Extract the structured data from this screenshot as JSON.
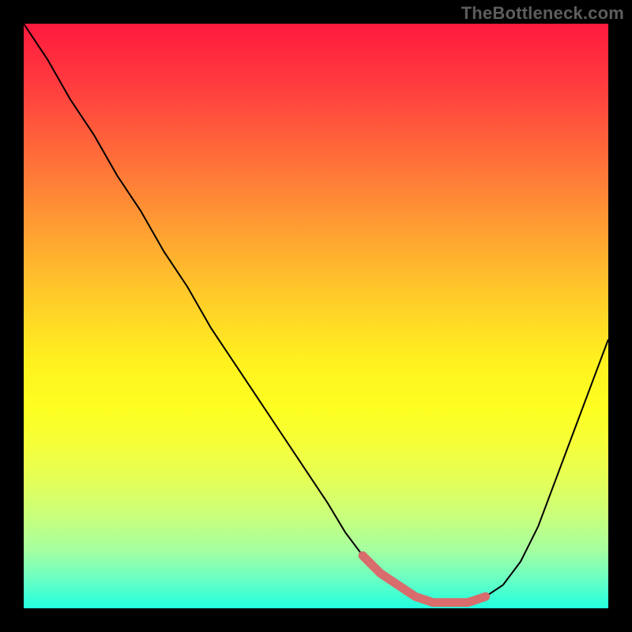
{
  "watermark": "TheBottleneck.com",
  "chart_data": {
    "type": "line",
    "title": "",
    "xlabel": "",
    "ylabel": "",
    "xlim": [
      0,
      100
    ],
    "ylim": [
      0,
      100
    ],
    "grid": false,
    "background": "red-to-green vertical gradient",
    "series": [
      {
        "name": "curve",
        "color": "#000000",
        "stroke_width": 2,
        "x": [
          0,
          4,
          8,
          12,
          16,
          20,
          24,
          28,
          32,
          36,
          40,
          44,
          48,
          52,
          55,
          58,
          61,
          64,
          67,
          70,
          73,
          76,
          79,
          82,
          85,
          88,
          91,
          94,
          97,
          100
        ],
        "y": [
          100,
          94,
          87,
          81,
          74,
          68,
          61,
          55,
          48,
          42,
          36,
          30,
          24,
          18,
          13,
          9,
          6,
          4,
          2,
          1,
          1,
          1,
          2,
          4,
          8,
          14,
          22,
          30,
          38,
          46
        ]
      },
      {
        "name": "highlight-band",
        "color": "#d96c6c",
        "stroke_width": 11,
        "stroke_linecap": "round",
        "x": [
          58,
          61,
          64,
          67,
          70,
          73,
          76,
          79
        ],
        "y": [
          9,
          6,
          4,
          2,
          1,
          1,
          1,
          2
        ]
      }
    ],
    "legend": false
  }
}
